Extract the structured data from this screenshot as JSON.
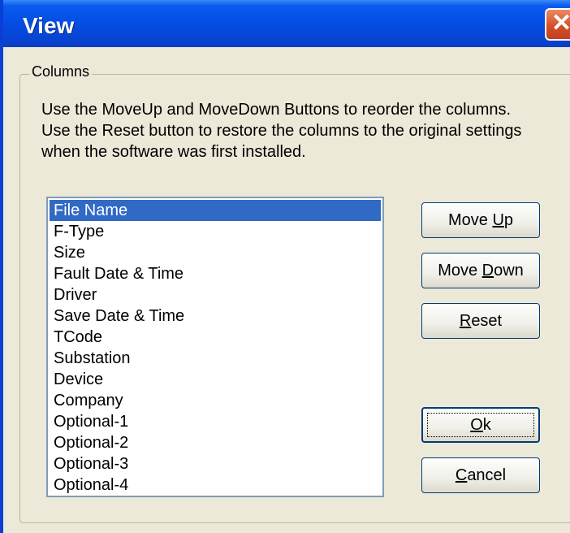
{
  "window": {
    "title": "View",
    "close_glyph": "✕"
  },
  "group": {
    "label": "Columns"
  },
  "description": [
    "Use the MoveUp and MoveDown Buttons to reorder the columns.",
    "Use the Reset button to restore the columns to the original settings",
    "when the software was first installed."
  ],
  "columns": {
    "items": [
      "File Name",
      "F-Type",
      "Size",
      "Fault Date & Time",
      "Driver",
      "Save Date & Time",
      "TCode",
      "Substation",
      "Device",
      "Company",
      "Optional-1",
      "Optional-2",
      "Optional-3",
      "Optional-4"
    ],
    "selected_index": 0
  },
  "buttons": {
    "move_up": {
      "pre": "Move ",
      "key": "U",
      "post": "p"
    },
    "move_down": {
      "pre": "Move ",
      "key": "D",
      "post": "own"
    },
    "reset": {
      "pre": "",
      "key": "R",
      "post": "eset"
    },
    "ok": {
      "pre": "",
      "key": "O",
      "post": "k"
    },
    "cancel": {
      "pre": "",
      "key": "C",
      "post": "ancel"
    }
  },
  "colors": {
    "titlebar": "#0550e6",
    "selection": "#316ac5",
    "close_button": "#d5502a",
    "dialog_bg": "#ece9d8"
  }
}
